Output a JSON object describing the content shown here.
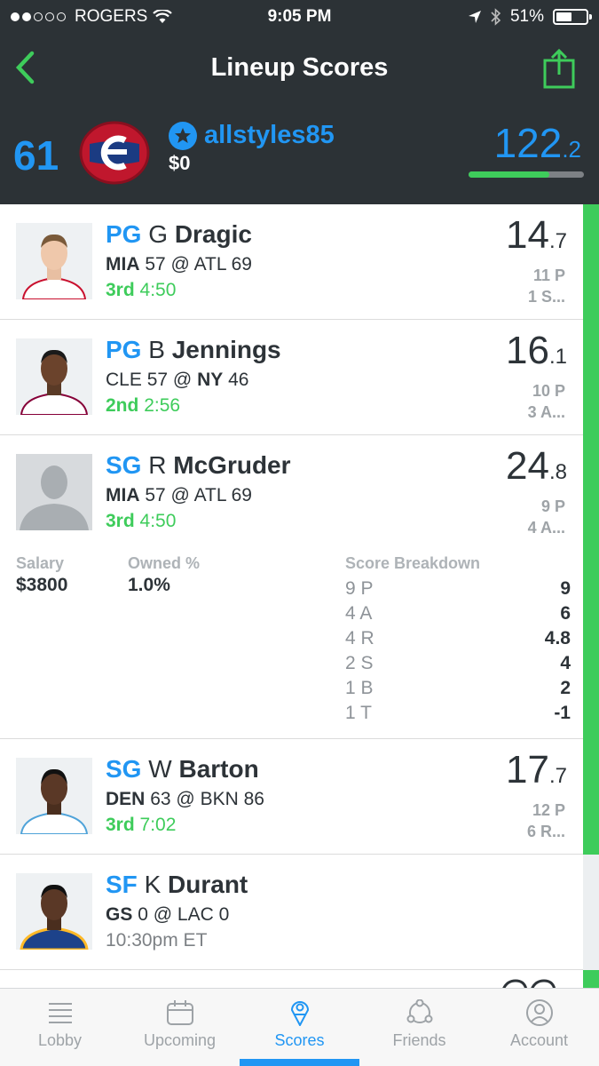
{
  "status": {
    "carrier": "ROGERS",
    "time": "9:05 PM",
    "battery": "51%"
  },
  "header": {
    "title": "Lineup Scores"
  },
  "team": {
    "rank": "61",
    "username": "allstyles85",
    "winnings": "$0",
    "score_int": "122",
    "score_dec": ".2",
    "progress": 0.7
  },
  "players": [
    {
      "pos": "PG",
      "initial": "G",
      "last": "Dragic",
      "team1": "MIA",
      "score1": "57",
      "at": "@",
      "team2": "ATL",
      "score2": "69",
      "bold_team": 1,
      "period": "3rd",
      "clock": "4:50",
      "fp_int": "14",
      "fp_dec": ".7",
      "stat1": "11 P",
      "stat2": "1 S..."
    },
    {
      "pos": "PG",
      "initial": "B",
      "last": "Jennings",
      "team1": "CLE",
      "score1": "57",
      "at": "@",
      "team2": "NY",
      "score2": "46",
      "bold_team": 2,
      "period": "2nd",
      "clock": "2:56",
      "fp_int": "16",
      "fp_dec": ".1",
      "stat1": "10 P",
      "stat2": "3 A..."
    },
    {
      "pos": "SG",
      "initial": "R",
      "last": "McGruder",
      "team1": "MIA",
      "score1": "57",
      "at": "@",
      "team2": "ATL",
      "score2": "69",
      "bold_team": 1,
      "period": "3rd",
      "clock": "4:50",
      "fp_int": "24",
      "fp_dec": ".8",
      "stat1": "9 P",
      "stat2": "4 A...",
      "detail": {
        "salary_label": "Salary",
        "salary": "$3800",
        "owned_label": "Owned %",
        "owned": "1.0%",
        "breakdown_label": "Score Breakdown",
        "breakdown": [
          {
            "k": "9 P",
            "v": "9"
          },
          {
            "k": "4 A",
            "v": "6"
          },
          {
            "k": "4 R",
            "v": "4.8"
          },
          {
            "k": "2 S",
            "v": "4"
          },
          {
            "k": "1 B",
            "v": "2"
          },
          {
            "k": "1 T",
            "v": "-1"
          }
        ]
      }
    },
    {
      "pos": "SG",
      "initial": "W",
      "last": "Barton",
      "team1": "DEN",
      "score1": "63",
      "at": "@",
      "team2": "BKN",
      "score2": "86",
      "bold_team": 1,
      "period": "3rd",
      "clock": "7:02",
      "fp_int": "17",
      "fp_dec": ".7",
      "stat1": "12 P",
      "stat2": "6 R..."
    },
    {
      "pos": "SF",
      "initial": "K",
      "last": "Durant",
      "team1": "GS",
      "score1": "0",
      "at": "@",
      "team2": "LAC",
      "score2": "0",
      "bold_team": 1,
      "period": "",
      "clock": "10:30pm ET",
      "fp_int": "",
      "fp_dec": "",
      "stat1": "",
      "stat2": ""
    }
  ],
  "tabs": [
    {
      "label": "Lobby",
      "icon": "lobby-list-icon"
    },
    {
      "label": "Upcoming",
      "icon": "calendar-icon"
    },
    {
      "label": "Scores",
      "icon": "scores-pin-icon"
    },
    {
      "label": "Friends",
      "icon": "friends-network-icon"
    },
    {
      "label": "Account",
      "icon": "account-person-icon"
    }
  ],
  "colors": {
    "accent": "#2196f3",
    "live": "#3ecc5b",
    "header_bg": "#2c3236"
  }
}
